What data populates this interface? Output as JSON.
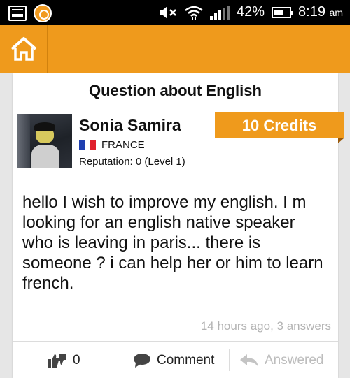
{
  "status_bar": {
    "battery_percent": "42%",
    "time": "8:19",
    "time_suffix": "am",
    "icons": [
      "gallery-icon",
      "app-circle-icon",
      "mute-icon",
      "wifi-icon",
      "signal-icon",
      "battery-icon"
    ]
  },
  "toolbar": {
    "home_icon": "home-icon",
    "accent_color": "#ef9a1c"
  },
  "question": {
    "title": "Question about English",
    "credits": "10 Credits",
    "author": {
      "name": "Sonia Samira",
      "country": "FRANCE",
      "reputation": "Reputation: 0 (Level 1)"
    },
    "body": "hello I wish to improve my english.  I m looking for an english native speaker who is leaving in paris... there is someone ? i can help her or him to learn french.",
    "meta": "14 hours ago, 3 answers"
  },
  "actions": {
    "vote_count": "0",
    "comment_label": "Comment",
    "answered_label": "Answered"
  }
}
